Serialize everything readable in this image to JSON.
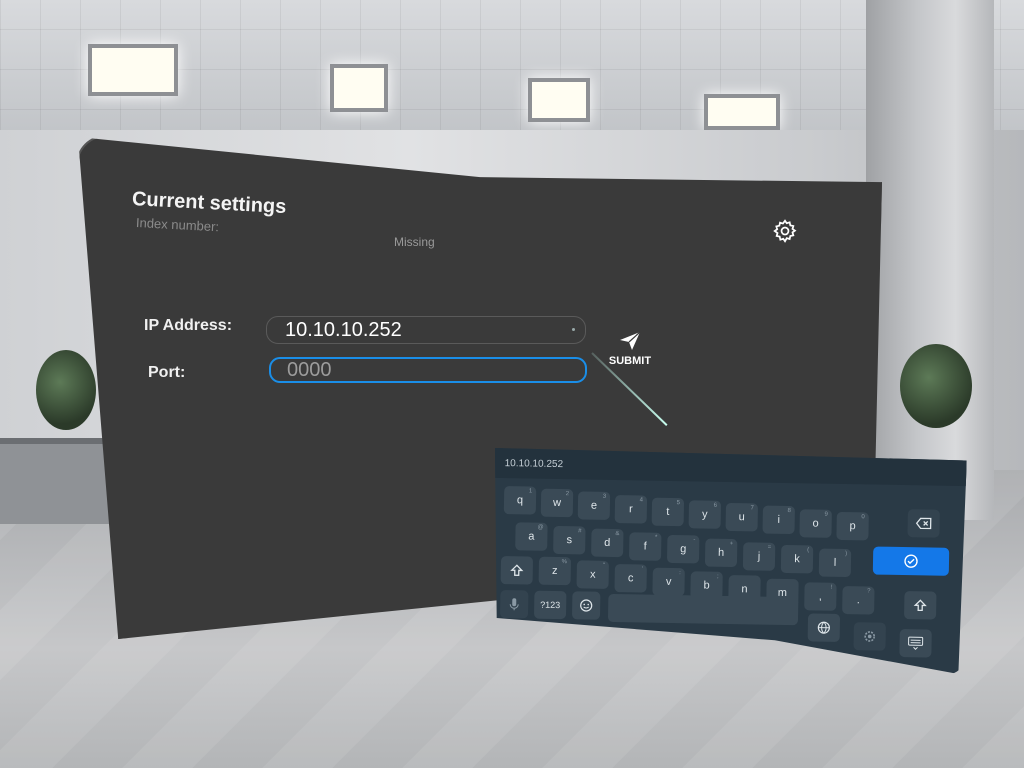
{
  "panel": {
    "title": "Current settings",
    "subtitle": "Index number:",
    "status": "Missing"
  },
  "form": {
    "ip_label": "IP Address:",
    "ip_value": "10.10.10.252",
    "port_label": "Port:",
    "port_placeholder": "0000",
    "submit_label": "SUBMIT"
  },
  "keyboard": {
    "preview_text": "10.10.10.252",
    "rows": [
      [
        {
          "k": "q",
          "s": "1"
        },
        {
          "k": "w",
          "s": "2"
        },
        {
          "k": "e",
          "s": "3"
        },
        {
          "k": "r",
          "s": "4"
        },
        {
          "k": "t",
          "s": "5"
        },
        {
          "k": "y",
          "s": "6"
        },
        {
          "k": "u",
          "s": "7"
        },
        {
          "k": "i",
          "s": "8"
        },
        {
          "k": "o",
          "s": "9"
        },
        {
          "k": "p",
          "s": "0"
        }
      ],
      [
        {
          "k": "a",
          "s": "@"
        },
        {
          "k": "s",
          "s": "#"
        },
        {
          "k": "d",
          "s": "&"
        },
        {
          "k": "f",
          "s": "*"
        },
        {
          "k": "g",
          "s": "-"
        },
        {
          "k": "h",
          "s": "+"
        },
        {
          "k": "j",
          "s": "="
        },
        {
          "k": "k",
          "s": "("
        },
        {
          "k": "l",
          "s": ")"
        }
      ],
      [
        {
          "k": "z",
          "s": "%"
        },
        {
          "k": "x",
          "s": "\""
        },
        {
          "k": "c",
          "s": "'"
        },
        {
          "k": "v",
          "s": ":"
        },
        {
          "k": "b",
          "s": ";"
        },
        {
          "k": "n",
          "s": ""
        },
        {
          "k": "m",
          "s": ""
        },
        {
          "k": ",",
          "s": "!"
        },
        {
          "k": ".",
          "s": "?"
        }
      ]
    ],
    "symbols_label": "?123",
    "icons": [
      "backspace-icon",
      "enter-check-icon",
      "shift-icon",
      "microphone-icon",
      "emoji-icon",
      "globe-icon",
      "settings-icon",
      "keyboard-hide-icon"
    ]
  },
  "colors": {
    "accent": "#1478e8",
    "panel_bg": "#3a3a3a",
    "keyboard_bg": "#2a3a46"
  }
}
